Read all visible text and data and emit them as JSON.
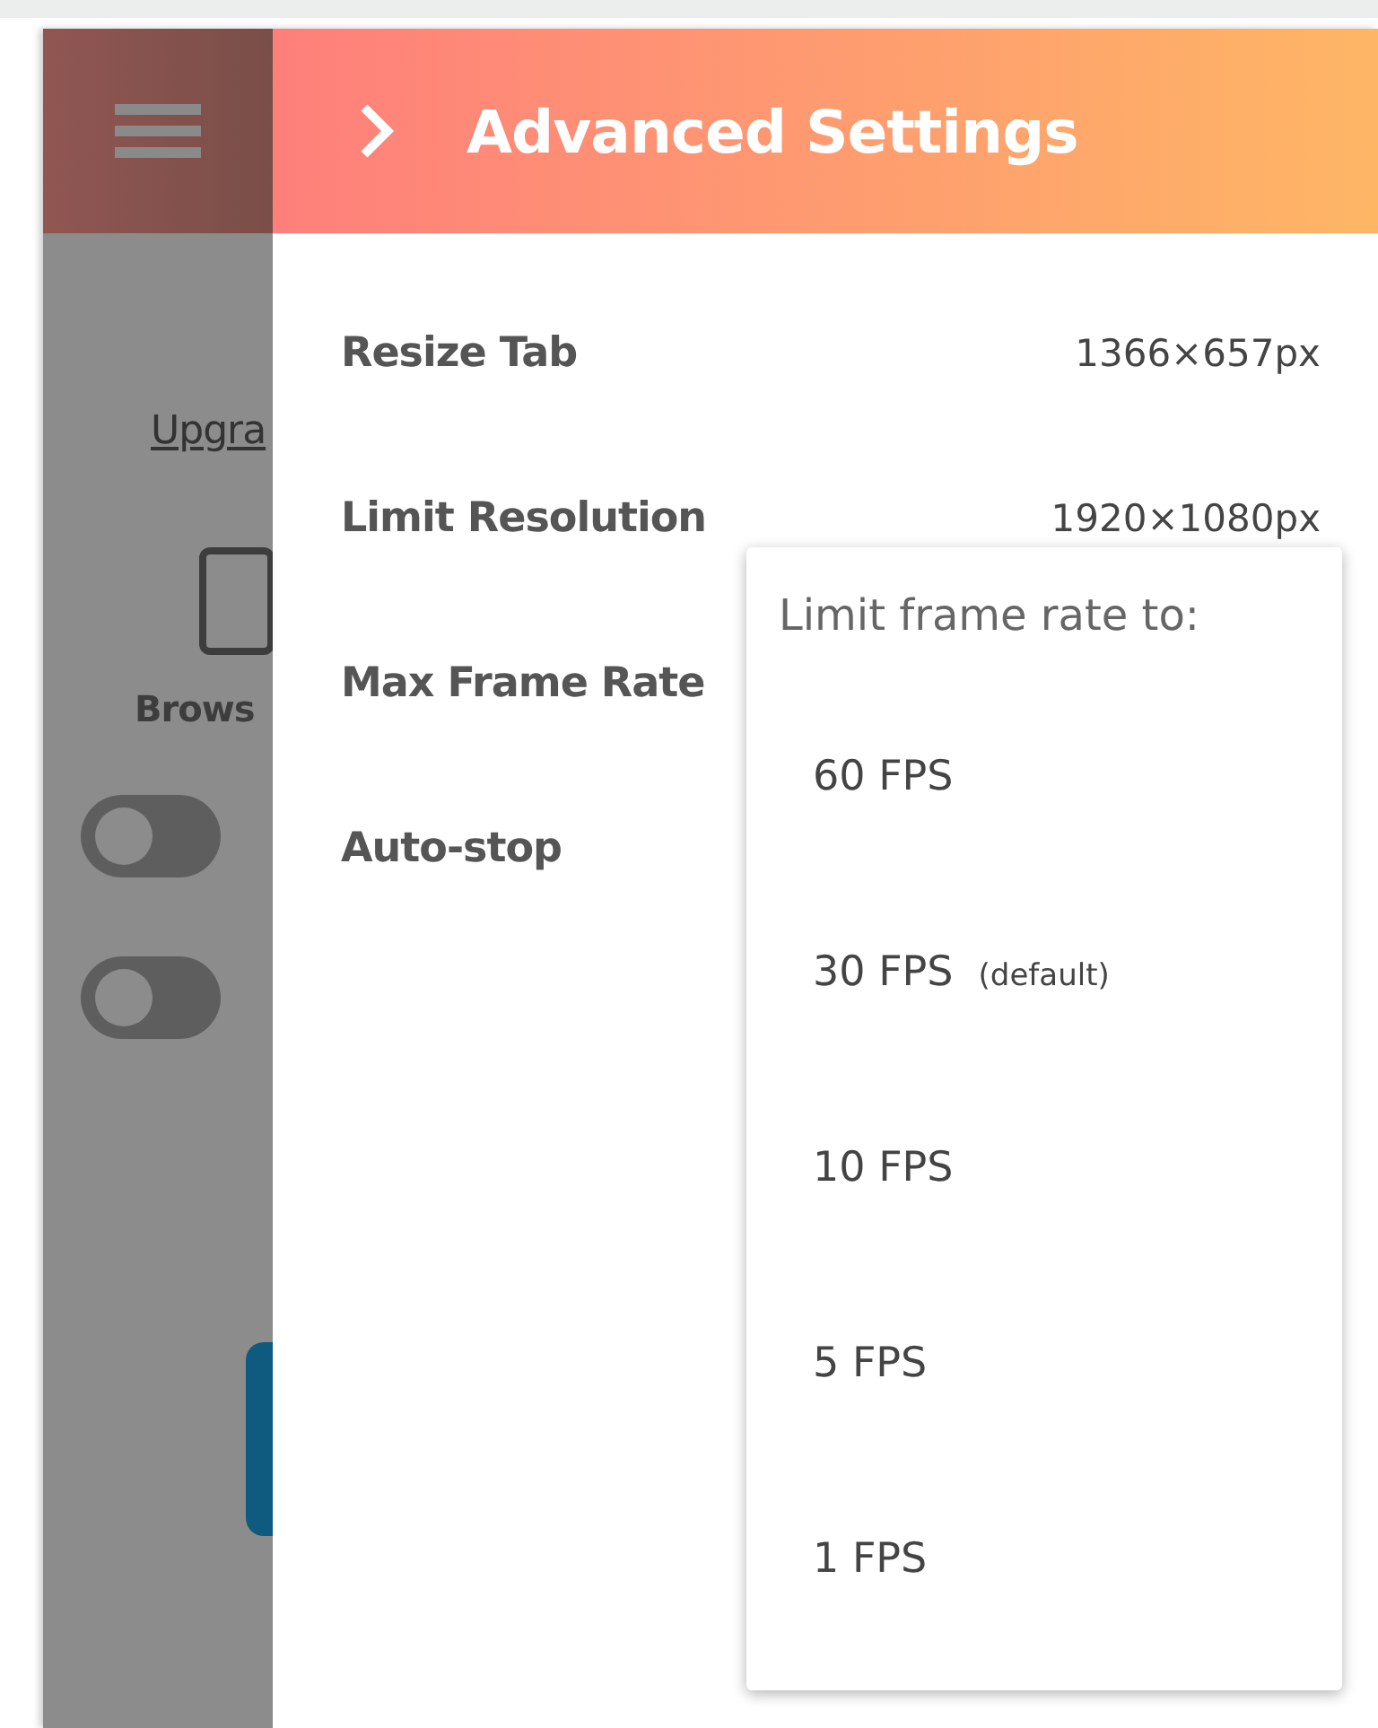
{
  "sidebar": {
    "link": "Upgra",
    "source_label": "Brows",
    "toggles": [
      {
        "on": false
      },
      {
        "on": false
      }
    ]
  },
  "header": {
    "title": "Advanced Settings"
  },
  "settings": [
    {
      "label": "Resize Tab",
      "value": "1366×657px"
    },
    {
      "label": "Limit Resolution",
      "value": "1920×1080px"
    },
    {
      "label": "Max Frame Rate"
    },
    {
      "label": "Auto-stop"
    }
  ],
  "frame_rate_menu": {
    "heading": "Limit frame rate to:",
    "options": [
      {
        "label": "60 FPS"
      },
      {
        "label": "30 FPS",
        "note": "(default)"
      },
      {
        "label": "10 FPS"
      },
      {
        "label": "5 FPS"
      },
      {
        "label": "1 FPS"
      }
    ]
  }
}
